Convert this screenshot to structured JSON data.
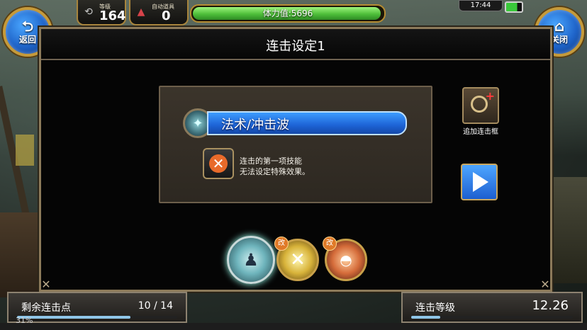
{
  "header": {
    "back": {
      "glyph": "⮌",
      "label": "返回"
    },
    "close": {
      "glyph": "⌂",
      "label": "关闭"
    },
    "level_label": "等级",
    "level_value": "164",
    "items_label": "自动道具",
    "items_value": "0",
    "stamina_text": "体力值:5696",
    "stamina_fraction": 0.99,
    "clock": "17:44"
  },
  "dialog": {
    "title": "连击设定1",
    "skill_name": "法术/冲击波",
    "note_line1": "连击的第一项技能",
    "note_line2": "无法设定特殊效果。",
    "add_slot_label": "追加连击框",
    "orb_badge": "改"
  },
  "bottom": {
    "points_label": "剩余连击点",
    "points_value": "10 / 14",
    "points_fraction": 0.71,
    "level_label": "连击等级",
    "level_value": "12.26",
    "level_fraction": 0.18,
    "battery_pct": "31%"
  },
  "colors": {
    "accent_blue": "#1d63d6",
    "stamina_green": "#4fbf3a",
    "frame_gold": "#c59a3b"
  },
  "icons": {
    "back": "back-arrow-icon",
    "close": "home-icon",
    "level": "level-icon",
    "items": "potion-icon",
    "battery": "battery-icon",
    "add": "add-combo-slot-icon",
    "next": "play-arrow-icon",
    "skill_orbs": [
      "ice-figure-skill-icon",
      "crossed-swords-skill-icon",
      "fire-dome-skill-icon"
    ]
  }
}
